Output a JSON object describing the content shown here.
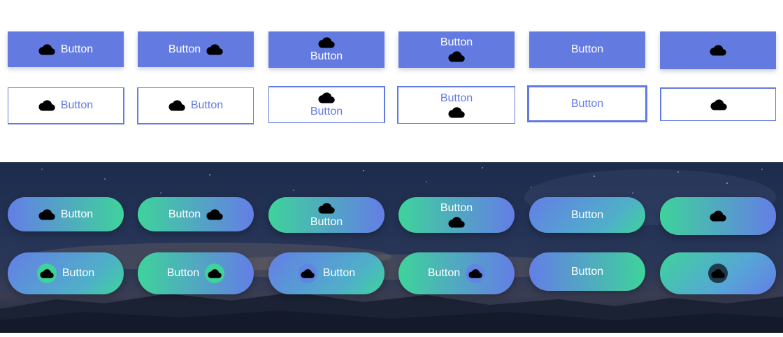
{
  "buttons": {
    "label": "Button",
    "icon": "cloud-download-icon"
  },
  "colors": {
    "primary": "#637be0",
    "gradient_blue": "#647ee6",
    "gradient_green": "#3ed39b",
    "dark_background": "#1d2c4b"
  }
}
